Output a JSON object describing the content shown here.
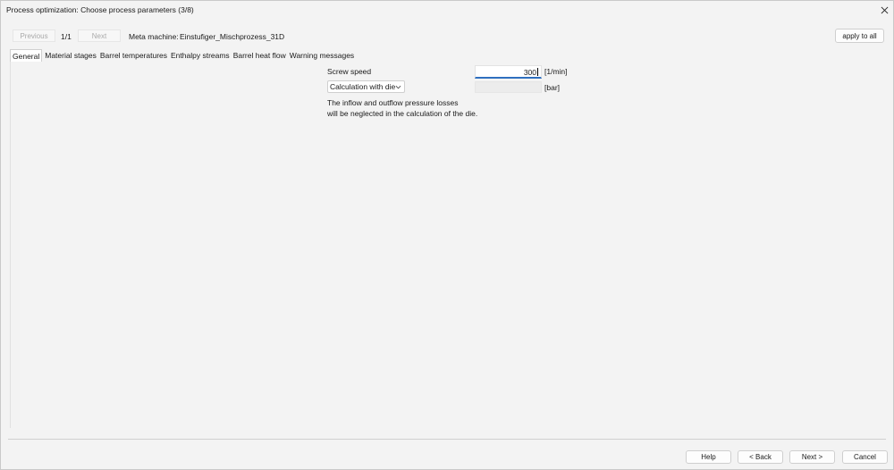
{
  "window": {
    "title": "Process optimization: Choose process parameters (3/8)"
  },
  "nav": {
    "previous_label": "Previous",
    "pager_text": "1/1",
    "next_label": "Next",
    "meta_label": "Meta machine:",
    "meta_value": "Einstufiger_Mischprozess_31D",
    "apply_label": "apply to all"
  },
  "tabs": [
    {
      "label": "General",
      "active": true
    },
    {
      "label": "Material stages"
    },
    {
      "label": "Barrel temperatures"
    },
    {
      "label": "Enthalpy streams"
    },
    {
      "label": "Barrel heat flow"
    },
    {
      "label": "Warning messages"
    }
  ],
  "general": {
    "screw_speed_label": "Screw speed",
    "screw_speed_value": "300",
    "screw_speed_unit": "[1/min]",
    "die_mode_selected": "Calculation with die",
    "pressure_value": "",
    "pressure_unit": "[bar]",
    "note_line1": "The inflow and outflow pressure losses",
    "note_line2": "will be neglected in the calculation of the die."
  },
  "footer": {
    "help_label": "Help",
    "back_label": "< Back",
    "next_label": "Next >",
    "cancel_label": "Cancel"
  },
  "colors": {
    "accent": "#2f6fbf",
    "window_bg": "#f3f3f3"
  }
}
